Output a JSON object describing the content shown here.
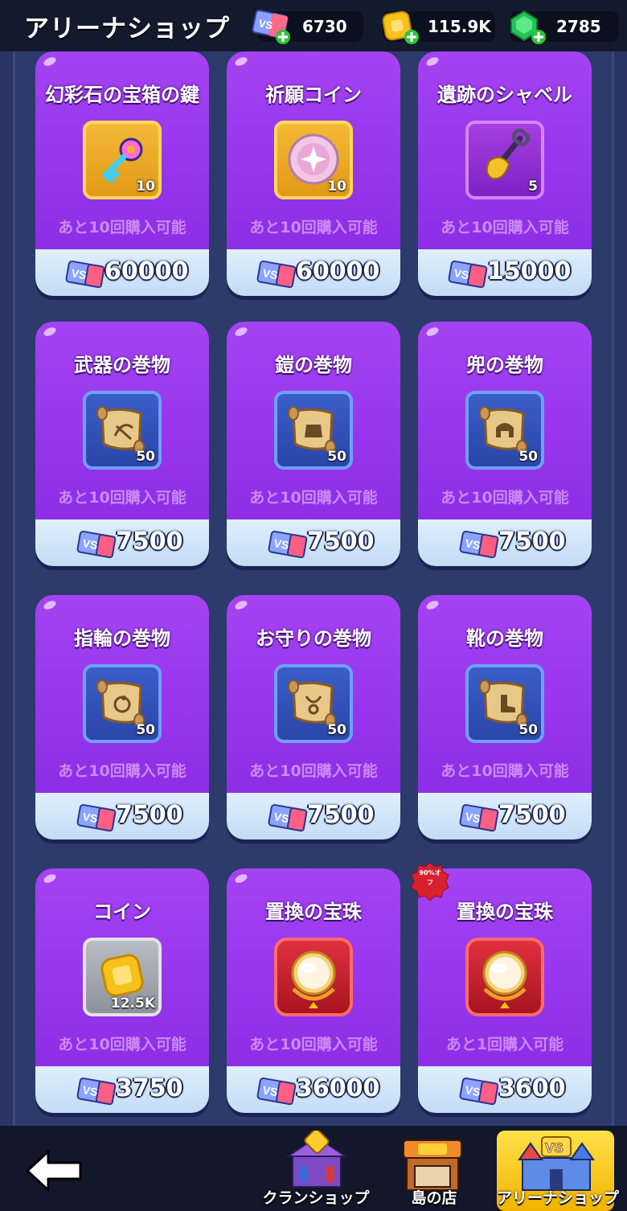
{
  "header": {
    "title": "アリーナショップ",
    "currencies": [
      {
        "icon": "vs-ticket-icon",
        "value": "6730"
      },
      {
        "icon": "gold-coin-icon",
        "value": "115.9K"
      },
      {
        "icon": "green-gem-icon",
        "value": "2785"
      }
    ]
  },
  "items": [
    {
      "name": "幻彩石の宝箱の鍵",
      "icon": "key-icon",
      "qty": "10",
      "limit": "あと10回購入可能",
      "price": "60000"
    },
    {
      "name": "祈願コイン",
      "icon": "wish-coin-icon",
      "qty": "10",
      "limit": "あと10回購入可能",
      "price": "60000"
    },
    {
      "name": "遺跡のシャベル",
      "icon": "shovel-icon",
      "qty": "5",
      "limit": "あと10回購入可能",
      "price": "15000"
    },
    {
      "name": "武器の巻物",
      "icon": "weapon-scroll-icon",
      "qty": "50",
      "limit": "あと10回購入可能",
      "price": "7500"
    },
    {
      "name": "鎧の巻物",
      "icon": "armor-scroll-icon",
      "qty": "50",
      "limit": "あと10回購入可能",
      "price": "7500"
    },
    {
      "name": "兜の巻物",
      "icon": "helmet-scroll-icon",
      "qty": "50",
      "limit": "あと10回購入可能",
      "price": "7500"
    },
    {
      "name": "指輪の巻物",
      "icon": "ring-scroll-icon",
      "qty": "50",
      "limit": "あと10回購入可能",
      "price": "7500"
    },
    {
      "name": "お守りの巻物",
      "icon": "amulet-scroll-icon",
      "qty": "50",
      "limit": "あと10回購入可能",
      "price": "7500"
    },
    {
      "name": "靴の巻物",
      "icon": "boots-scroll-icon",
      "qty": "50",
      "limit": "あと10回購入可能",
      "price": "7500"
    },
    {
      "name": "コイン",
      "icon": "coin-icon",
      "qty": "12.5K",
      "limit": "あと10回購入可能",
      "price": "3750"
    },
    {
      "name": "置換の宝珠",
      "icon": "orb-icon",
      "qty": "",
      "limit": "あと10回購入可能",
      "price": "36000"
    },
    {
      "name": "置換の宝珠",
      "icon": "orb-icon",
      "qty": "",
      "limit": "あと1回購入可能",
      "price": "3600"
    }
  ],
  "sale_badge": {
    "line1": "90%オ",
    "line2": "フ"
  },
  "nav": {
    "tabs": [
      {
        "label": "クランショップ"
      },
      {
        "label": "島の店"
      },
      {
        "label": "アリーナショップ"
      }
    ]
  },
  "colors": {
    "card_purple": "#9635ec",
    "price_bar": "#d4e8fa",
    "active_tab": "#f8c81a"
  }
}
